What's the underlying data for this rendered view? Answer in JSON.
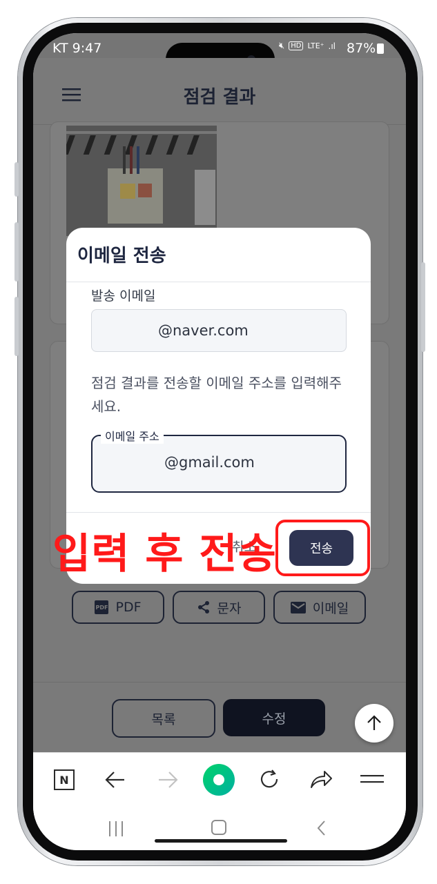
{
  "status_bar": {
    "carrier_time": "KT 9:47",
    "battery": "87%"
  },
  "header": {
    "title": "점검 결과"
  },
  "actions": {
    "pdf": "PDF",
    "sms": "문자",
    "email": "이메일"
  },
  "footer": {
    "list": "목록",
    "edit": "수정"
  },
  "modal": {
    "title": "이메일 전송",
    "sender_label": "발송 이메일",
    "sender_value": "@naver.com",
    "instruction": "점검 결과를 전송할 이메일 주소를 입력해주세요.",
    "recipient_label": "이메일 주소",
    "recipient_value": "@gmail.com",
    "cancel": "취소",
    "send": "전송"
  },
  "annotation": {
    "text": "입력 후 전송",
    "color": "#ff1a1a"
  },
  "colors": {
    "accent_dark": "#2e3452",
    "navy": "#1c2233",
    "overlay": "#7a7a7a"
  }
}
